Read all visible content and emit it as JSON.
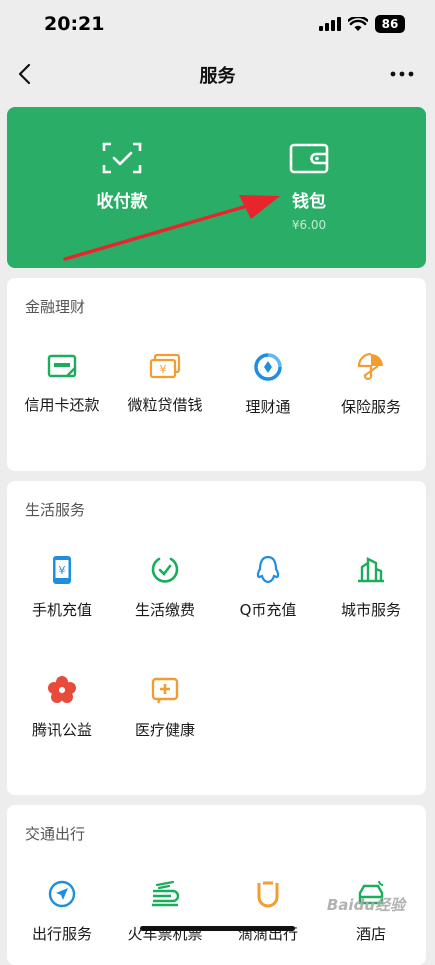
{
  "status_bar": {
    "time": "20:21",
    "battery": "86"
  },
  "nav": {
    "title": "服务"
  },
  "wallet_card": {
    "collect_label": "收付款",
    "wallet_label": "钱包",
    "wallet_balance": "¥6.00"
  },
  "finance": {
    "title": "金融理财",
    "items": [
      {
        "label": "信用卡还款",
        "icon": "credit-card-icon"
      },
      {
        "label": "微粒贷借钱",
        "icon": "loan-icon"
      },
      {
        "label": "理财通",
        "icon": "wealth-icon"
      },
      {
        "label": "保险服务",
        "icon": "insurance-icon"
      }
    ]
  },
  "life": {
    "title": "生活服务",
    "items": [
      {
        "label": "手机充值",
        "icon": "phone-topup-icon"
      },
      {
        "label": "生活缴费",
        "icon": "utility-bill-icon"
      },
      {
        "label": "Q币充值",
        "icon": "qq-coin-icon"
      },
      {
        "label": "城市服务",
        "icon": "city-service-icon"
      },
      {
        "label": "腾讯公益",
        "icon": "charity-icon"
      },
      {
        "label": "医疗健康",
        "icon": "medical-icon"
      }
    ]
  },
  "travel": {
    "title": "交通出行",
    "items": [
      {
        "label": "出行服务",
        "icon": "travel-service-icon"
      },
      {
        "label": "火车票机票",
        "icon": "train-ticket-icon"
      },
      {
        "label": "滴滴出行",
        "icon": "didi-icon"
      },
      {
        "label": "酒店",
        "icon": "hotel-icon"
      }
    ]
  },
  "watermark": "Baidu经验",
  "colors": {
    "wallet_green": "#2aae67",
    "icon_green": "#1aad5b",
    "icon_orange": "#f39c2f",
    "icon_blue": "#1e8fe0",
    "icon_red": "#e84a3b",
    "arrow_red": "#e8242c"
  }
}
